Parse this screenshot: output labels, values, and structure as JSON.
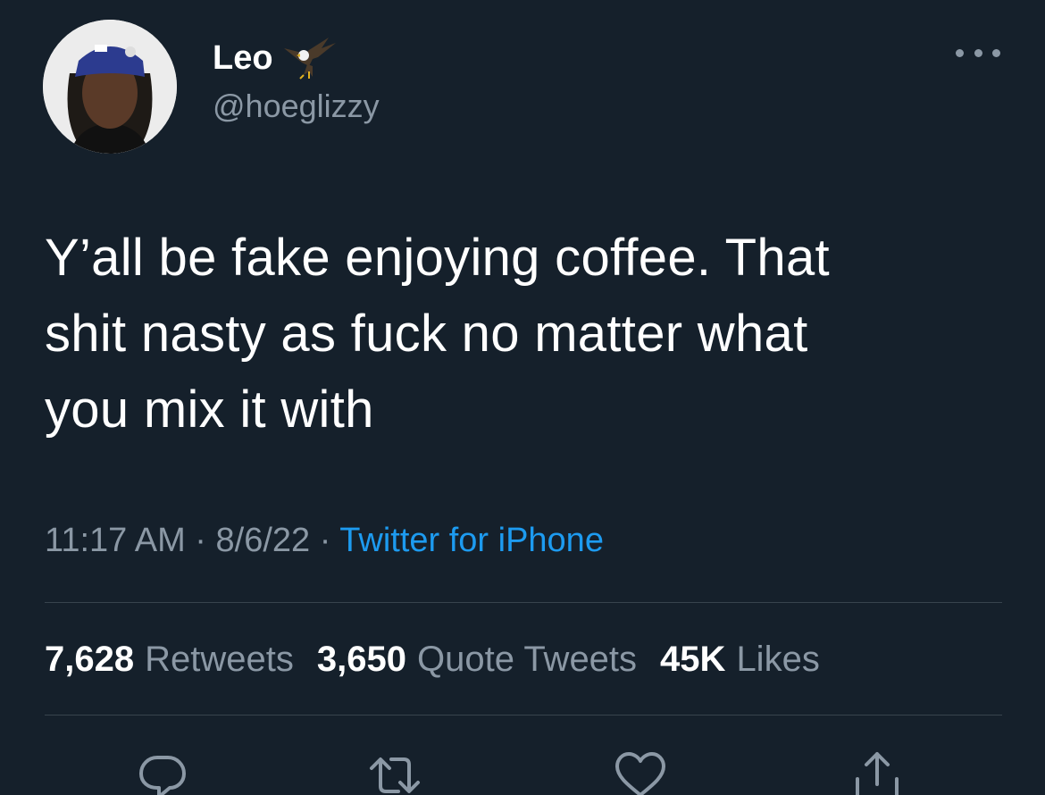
{
  "user": {
    "display_name": "Leo",
    "handle": "@hoeglizzy",
    "badge_icon": "eagle-icon"
  },
  "tweet": {
    "text": "Y’all be fake enjoying coffee. That\nshit nasty as fuck no matter what\nyou mix it with",
    "time": "11:17 AM",
    "separator": " · ",
    "date": "8/6/22",
    "source": "Twitter for iPhone"
  },
  "stats": {
    "retweets_count": "7,628",
    "retweets_label": "Retweets",
    "quotes_count": "3,650",
    "quotes_label": "Quote Tweets",
    "likes_count": "45K",
    "likes_label": "Likes"
  },
  "actions": [
    "reply-icon",
    "retweet-icon",
    "like-icon",
    "share-icon"
  ],
  "colors": {
    "background": "#15202b",
    "secondary_text": "#8b98a5",
    "link": "#1d9bf0",
    "divider": "#38444d"
  }
}
